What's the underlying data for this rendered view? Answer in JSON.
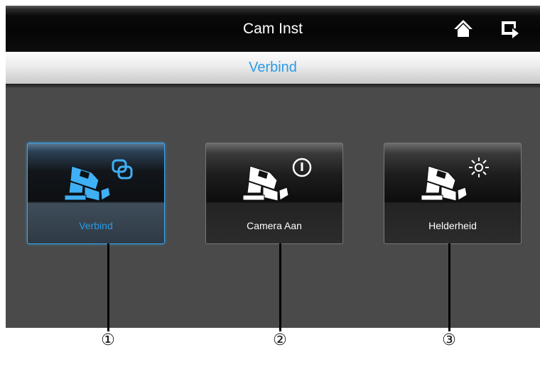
{
  "header": {
    "title": "Cam Inst",
    "home_icon": "home-icon",
    "back_icon": "back-icon"
  },
  "subheader": {
    "title": "Verbind"
  },
  "tiles": [
    {
      "label": "Verbind",
      "icon": "camera-link-icon",
      "active": true
    },
    {
      "label": "Camera Aan",
      "icon": "camera-power-icon",
      "active": false
    },
    {
      "label": "Helderheid",
      "icon": "camera-brightness-icon",
      "active": false
    }
  ],
  "callouts": [
    "①",
    "②",
    "③"
  ],
  "colors": {
    "accent": "#2b9be5",
    "screen_bg": "#4a4a4a",
    "header_bg": "#050505"
  }
}
